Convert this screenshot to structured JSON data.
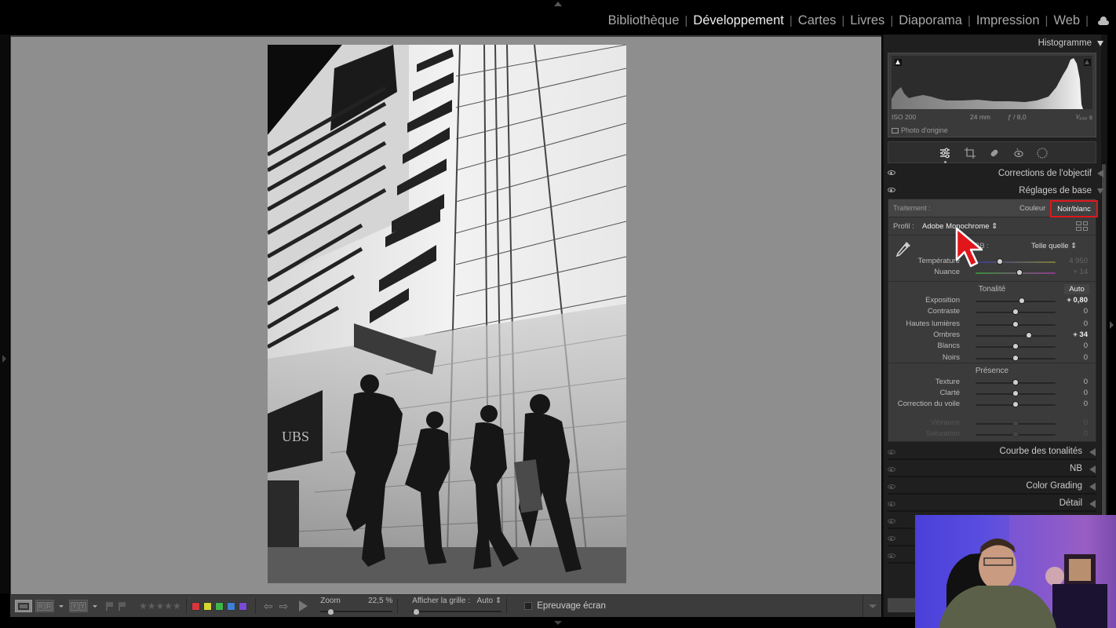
{
  "modules": {
    "items": [
      {
        "label": "Bibliothèque",
        "active": false
      },
      {
        "label": "Développement",
        "active": true
      },
      {
        "label": "Cartes",
        "active": false
      },
      {
        "label": "Livres",
        "active": false
      },
      {
        "label": "Diaporama",
        "active": false
      },
      {
        "label": "Impression",
        "active": false
      },
      {
        "label": "Web",
        "active": false
      }
    ],
    "cloud_icon": "cloud-icon"
  },
  "photo": {
    "description": "Black and white photo: low-angle modern building facade with four young people walking past, UBS sign on left",
    "sign_text": "UBS"
  },
  "histogram": {
    "title": "Histogramme",
    "iso": "ISO 200",
    "focal": "24 mm",
    "aperture": "ƒ / 8,0",
    "shutter": "¹⁄₂₀₀ s",
    "original_photo_label": "Photo d'origine"
  },
  "tools": [
    "edit-sliders-icon",
    "crop-icon",
    "healing-icon",
    "red-eye-icon",
    "masking-icon"
  ],
  "panels": {
    "lens_corrections": "Corrections de l'objectif",
    "basic": "Réglages de base"
  },
  "basic": {
    "treatment_label": "Traitement :",
    "treatment_color": "Couleur",
    "treatment_bw": "Noir/blanc",
    "profile_label": "Profil :",
    "profile_value": "Adobe Monochrome ⇕",
    "wb_label": "BB :",
    "wb_value": "Telle quelle ⇕",
    "temperature": {
      "label": "Température",
      "value": "4 950",
      "position": 0.3
    },
    "tint": {
      "label": "Nuance",
      "value": "+ 14",
      "position": 0.55
    },
    "tone_title": "Tonalité",
    "auto_label": "Auto",
    "tone": [
      {
        "label": "Exposition",
        "value": "+ 0,80",
        "position": 0.58,
        "modified": true
      },
      {
        "label": "Contraste",
        "value": "0",
        "position": 0.5,
        "modified": false
      },
      {
        "label": "Hautes lumières",
        "value": "0",
        "position": 0.5,
        "modified": false
      },
      {
        "label": "Ombres",
        "value": "+ 34",
        "position": 0.67,
        "modified": true
      },
      {
        "label": "Blancs",
        "value": "0",
        "position": 0.5,
        "modified": false
      },
      {
        "label": "Noirs",
        "value": "0",
        "position": 0.5,
        "modified": false
      }
    ],
    "presence_title": "Présence",
    "presence": [
      {
        "label": "Texture",
        "value": "0",
        "position": 0.5,
        "disabled": false
      },
      {
        "label": "Clarté",
        "value": "0",
        "position": 0.5,
        "disabled": false
      },
      {
        "label": "Correction du voile",
        "value": "0",
        "position": 0.5,
        "disabled": false
      },
      {
        "label": "Vibrance",
        "value": "0",
        "position": 0.5,
        "disabled": true
      },
      {
        "label": "Saturation",
        "value": "0",
        "position": 0.5,
        "disabled": true
      }
    ]
  },
  "sections": [
    "Courbe des tonalités",
    "NB",
    "Color Grading",
    "Détail"
  ],
  "toolbar": {
    "stars": "★★★★★",
    "color_labels": [
      "#d9363e",
      "#d6d630",
      "#3fb54a",
      "#3d7fd6",
      "#7a4bd6"
    ],
    "zoom_label": "Zoom",
    "zoom_value": "22,5 %",
    "grid_label": "Afficher la grille :",
    "grid_value": "Auto ⇕",
    "softproof_label": "Epreuvage écran"
  },
  "highlight_color": "#e0161b"
}
